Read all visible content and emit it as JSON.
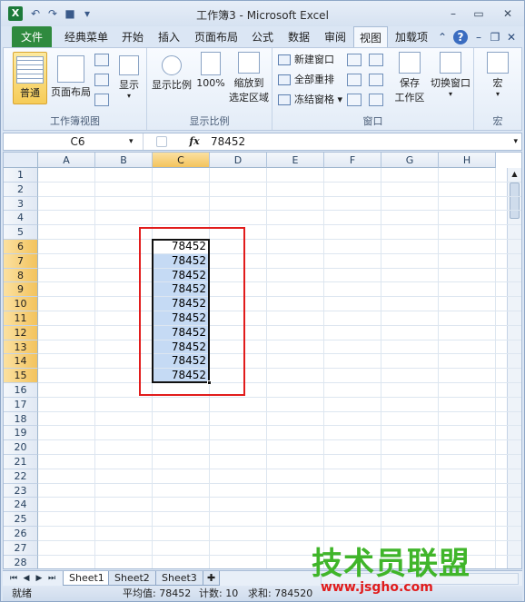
{
  "window": {
    "title": "工作簿3 - Microsoft Excel"
  },
  "qat": [
    "save-icon",
    "undo-icon",
    "redo-icon"
  ],
  "tabs": [
    "文件",
    "经典菜单",
    "开始",
    "插入",
    "页面布局",
    "公式",
    "数据",
    "审阅",
    "视图",
    "加载项"
  ],
  "ribbon": {
    "group1": {
      "label": "工作簿视图",
      "normal": "普通",
      "page_layout": "页面布局",
      "show": "显示"
    },
    "group2": {
      "label": "显示比例",
      "zoom": "显示比例",
      "zoom100": "100%",
      "zoom_sel_1": "缩放到",
      "zoom_sel_2": "选定区域"
    },
    "group3": {
      "label": "窗口",
      "new_window": "新建窗口",
      "arrange_all": "全部重排",
      "freeze": "冻结窗格",
      "save_ws_1": "保存",
      "save_ws_2": "工作区",
      "switch_1": "切换窗口"
    },
    "group4": {
      "label": "宏",
      "macro": "宏"
    }
  },
  "formula_bar": {
    "name_box": "C6",
    "fx": "fx",
    "value": "78452"
  },
  "columns": [
    "A",
    "B",
    "C",
    "D",
    "E",
    "F",
    "G",
    "H"
  ],
  "rows": [
    "1",
    "2",
    "3",
    "4",
    "5",
    "6",
    "7",
    "8",
    "9",
    "10",
    "11",
    "12",
    "13",
    "14",
    "15",
    "16",
    "17",
    "18",
    "19",
    "20",
    "21",
    "22",
    "23",
    "24",
    "25",
    "26",
    "27",
    "28"
  ],
  "cells": [
    "78452",
    "78452",
    "78452",
    "78452",
    "78452",
    "78452",
    "78452",
    "78452",
    "78452",
    "78452"
  ],
  "sheets": [
    "Sheet1",
    "Sheet2",
    "Sheet3"
  ],
  "status": {
    "ready": "就绪",
    "average": "平均值: 78452",
    "count": "计数: 10",
    "sum": "求和: 784520"
  },
  "watermark": {
    "name": "技术员联盟",
    "url": "www.jsgho.com"
  }
}
